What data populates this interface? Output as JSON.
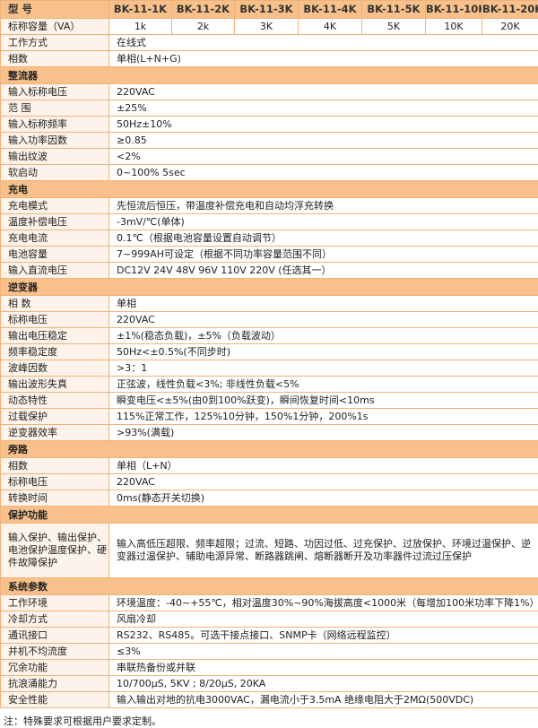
{
  "header": {
    "label": "型  号",
    "models": [
      "BK-11-1K",
      "BK-11-2K",
      "BK-11-3K",
      "BK-11-4K",
      "BK-11-5K",
      "BK-11-10K",
      "BK-11-20K"
    ]
  },
  "capacity": {
    "label": "标称容量（VA）",
    "values": [
      "1k",
      "2k",
      "3K",
      "4K",
      "5K",
      "10K",
      "20K"
    ]
  },
  "general": [
    {
      "label": "工作方式",
      "value": "在线式"
    },
    {
      "label": "相数",
      "value": "单相(L+N+G)"
    }
  ],
  "sections": [
    {
      "title": "整流器",
      "rows": [
        {
          "label": "输入标称电压",
          "value": "220VAC"
        },
        {
          "label": "范  围",
          "value": "±25%"
        },
        {
          "label": "输入标称频率",
          "value": "50Hz±10%"
        },
        {
          "label": "输入功率因数",
          "value": "≥0.85"
        },
        {
          "label": "输出纹波",
          "value": "<2%"
        },
        {
          "label": "软启动",
          "value": "0~100% 5sec"
        }
      ]
    },
    {
      "title": "充电",
      "rows": [
        {
          "label": "充电模式",
          "value": "先恒流后恒压，带温度补偿充电和自动均浮充转换"
        },
        {
          "label": "温度补偿电压",
          "value": "-3mV/℃(单体)"
        },
        {
          "label": "充电电流",
          "value": "0.1℃（根据电池容量设置自动调节）"
        },
        {
          "label": "电池容量",
          "value": "7~999AH可设定（根据不同功率容量范围不同）"
        },
        {
          "label": "输入直流电压",
          "value": "DC12V 24V 48V 96V 110V 220V (任选其一）"
        }
      ]
    },
    {
      "title": "逆变器",
      "rows": [
        {
          "label": "相  数",
          "value": "单相"
        },
        {
          "label": "标称电压",
          "value": "220VAC"
        },
        {
          "label": "输出电压稳定",
          "value": "±1%(稳态负载)，±5%（负载波动）"
        },
        {
          "label": "频率稳定度",
          "value": "50Hz<±0.5%(不同步时)"
        },
        {
          "label": "波峰因数",
          "value": ">3：1"
        },
        {
          "label": "输出波形失真",
          "value": "正弦波，线性负载<3%; 非线性负载<5%"
        },
        {
          "label": "动态特性",
          "value": "瞬变电压<±5%(由0到100%跃变)，瞬间恢复时间<10ms"
        },
        {
          "label": "过载保护",
          "value": "115%正常工作，125%10分钟，150%1分钟，200%1s"
        },
        {
          "label": "逆变器效率",
          "value": ">93%(满载)"
        }
      ]
    },
    {
      "title": "旁路",
      "rows": [
        {
          "label": "相数",
          "value": "单相（L+N）"
        },
        {
          "label": "标称电压",
          "value": "220VAC"
        },
        {
          "label": "转换时间",
          "value": "0ms(静态开关切换)"
        }
      ]
    }
  ],
  "protection": {
    "title": "保护功能",
    "label": "输入保护、输出保护、电池保护温度保护、硬件故障保护",
    "value": "输入高低压超限、频率超限；过流、短路、功因过低、过充保护、过放保护、环境过温保护、逆变器过温保护、辅助电源异常、断路器跳闸、熔断器断开及功率器件过流过压保护"
  },
  "system": {
    "title": "系统参数",
    "rows": [
      {
        "label": "工作环境",
        "value": "环境温度：-40~+55℃，相对温度30%~90%海拔高度<1000米（每增加100米功率下降1%）"
      },
      {
        "label": "冷却方式",
        "value": "风扇冷却"
      },
      {
        "label": "通讯接口",
        "value": "RS232、RS485。可选干接点接口、SNMP卡（网络远程监控）"
      },
      {
        "label": "并机不均流度",
        "value": "≤3%"
      },
      {
        "label": "冗余功能",
        "value": "串联热备份或并联"
      },
      {
        "label": "抗浪涌能力",
        "value": "10/700μS, 5KV ; 8/20μS, 20KA"
      },
      {
        "label": "安全性能",
        "value": "输入输出对地的抗电3000VAC，漏电流小于3.5mA 绝缘电阻大于2MΩ(500VDC)"
      }
    ]
  },
  "note": "注：特殊要求可根据用户要求定制。",
  "colors": {
    "header_bg": "#f8c08a",
    "border": "#f0b27a",
    "label_bg": "#fdf3ea"
  }
}
